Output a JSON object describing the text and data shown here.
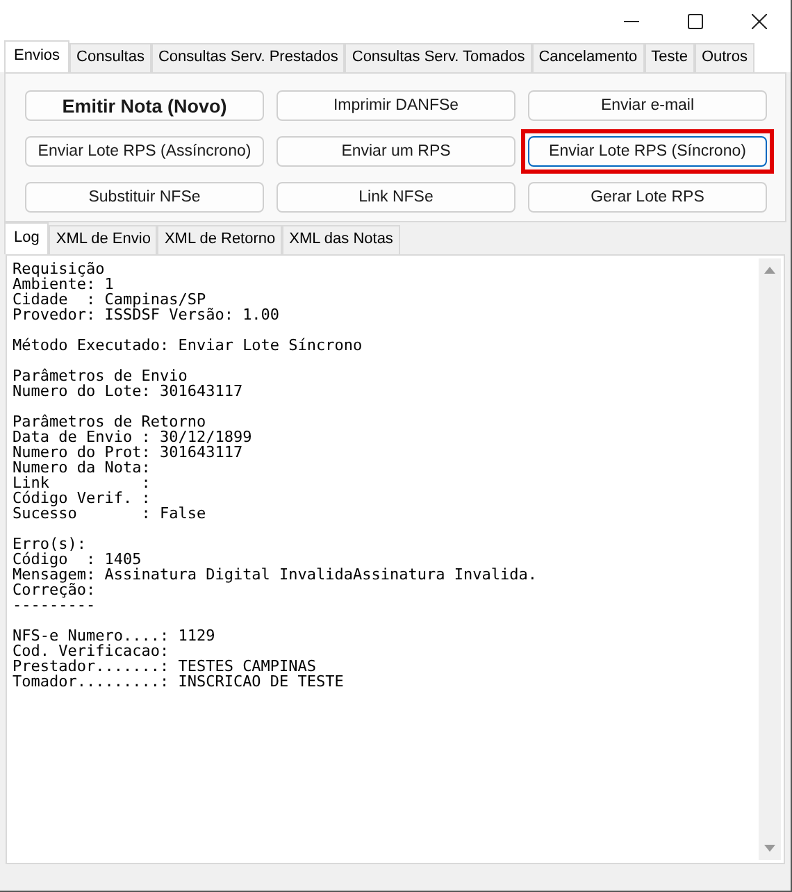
{
  "top_tabs": [
    {
      "label": "Envios",
      "selected": true
    },
    {
      "label": "Consultas",
      "selected": false
    },
    {
      "label": "Consultas Serv. Prestados",
      "selected": false
    },
    {
      "label": "Consultas Serv. Tomados",
      "selected": false
    },
    {
      "label": "Cancelamento",
      "selected": false
    },
    {
      "label": "Teste",
      "selected": false
    },
    {
      "label": "Outros",
      "selected": false
    }
  ],
  "buttons": [
    {
      "label": "Emitir Nota (Novo)",
      "kind": "bold",
      "highlighted": false
    },
    {
      "label": "Imprimir DANFSe",
      "kind": "normal",
      "highlighted": false
    },
    {
      "label": "Enviar e-mail",
      "kind": "normal",
      "highlighted": false
    },
    {
      "label": "Enviar Lote RPS (Assíncrono)",
      "kind": "normal",
      "highlighted": false
    },
    {
      "label": "Enviar um RPS",
      "kind": "normal",
      "highlighted": false
    },
    {
      "label": "Enviar Lote RPS (Síncrono)",
      "kind": "normal",
      "highlighted": true
    },
    {
      "label": "Substituir NFSe",
      "kind": "normal",
      "highlighted": false
    },
    {
      "label": "Link NFSe",
      "kind": "normal",
      "highlighted": false
    },
    {
      "label": "Gerar Lote RPS",
      "kind": "normal",
      "highlighted": false
    }
  ],
  "log_tabs": [
    {
      "label": "Log",
      "selected": true
    },
    {
      "label": "XML de Envio",
      "selected": false
    },
    {
      "label": "XML de Retorno",
      "selected": false
    },
    {
      "label": "XML das Notas",
      "selected": false
    }
  ],
  "log": [
    [
      "Requisição",
      "Ambiente: 1",
      "Cidade  : Campinas/SP",
      "Provedor: ISSDSF Versão: 1.00"
    ],
    [
      "Método Executado: Enviar Lote Síncrono"
    ],
    [
      "Parâmetros de Envio",
      "Numero do Lote: 301643117"
    ],
    [
      "Parâmetros de Retorno",
      "Data de Envio : 30/12/1899",
      "Numero do Prot: 301643117",
      "Numero da Nota:",
      "Link          :",
      "Código Verif. :",
      "Sucesso       : False"
    ],
    [
      "Erro(s):",
      "Código  : 1405",
      "Mensagem: Assinatura Digital InvalidaAssinatura Invalida.",
      "Correção:",
      "---------"
    ],
    [
      "NFS-e Numero....: 1129",
      "Cod. Verificacao:",
      "Prestador.......: TESTES CAMPINAS",
      "Tomador.........: INSCRICAO DE TESTE"
    ]
  ]
}
